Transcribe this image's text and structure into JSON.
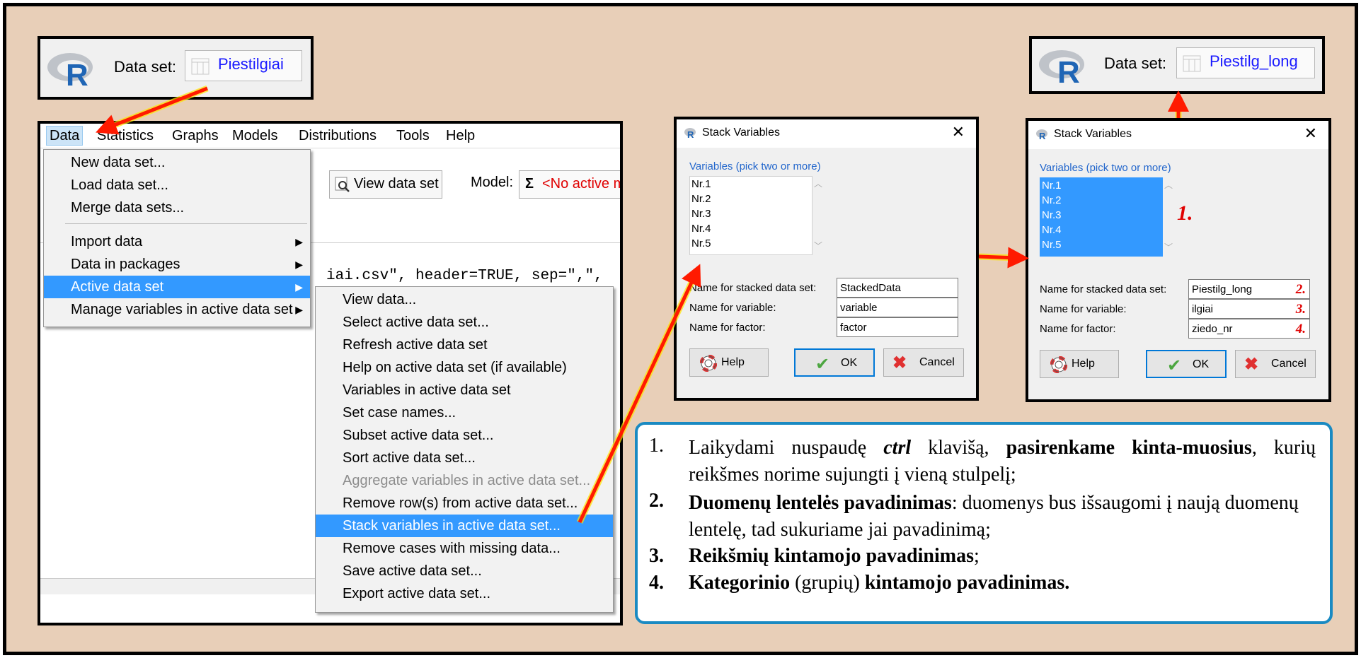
{
  "header_left": {
    "dataset_label": "Data set:",
    "dataset_value": "Piestilgiai"
  },
  "header_right": {
    "dataset_label": "Data set:",
    "dataset_value": "Piestilg_long"
  },
  "menubar": [
    "Data",
    "Statistics",
    "Graphs",
    "Models",
    "Distributions",
    "Tools",
    "Help"
  ],
  "toolbar": {
    "view_data_set": "View data set",
    "model_label": "Model:",
    "model_value": "<No active m"
  },
  "code_line": "iai.csv\", header=TRUE, sep=\",\",",
  "data_menu": {
    "items": [
      "New data set...",
      "Load data set...",
      "Merge data sets...",
      "Import data",
      "Data in packages",
      "Active data set",
      "Manage variables in active data set"
    ]
  },
  "active_menu": {
    "items": [
      "View data...",
      "Select active data set...",
      "Refresh active data set",
      "Help on active data set (if available)",
      "Variables in active data set",
      "Set case names...",
      "Subset active data set...",
      "Sort active data set...",
      "Aggregate variables in active data set...",
      "Remove row(s) from active data set...",
      "Stack variables in active data set...",
      "Remove cases with missing data...",
      "Save active data set...",
      "Export active data set..."
    ]
  },
  "dialog_left": {
    "title": "Stack Variables",
    "close": "✕",
    "list_label": "Variables (pick two or more)",
    "variables": [
      "Nr.1",
      "Nr.2",
      "Nr.3",
      "Nr.4",
      "Nr.5"
    ],
    "fields": [
      {
        "label": "Name for stacked data set:",
        "value": "StackedData"
      },
      {
        "label": "Name for variable:",
        "value": "variable"
      },
      {
        "label": "Name for factor:",
        "value": "factor"
      }
    ],
    "help": "Help",
    "ok": "OK",
    "cancel": "Cancel"
  },
  "dialog_right": {
    "title": "Stack Variables",
    "close": "✕",
    "list_label": "Variables (pick two or more)",
    "variables": [
      "Nr.1",
      "Nr.2",
      "Nr.3",
      "Nr.4",
      "Nr.5"
    ],
    "step1": "1.",
    "fields": [
      {
        "label": "Name for stacked data set:",
        "value": "Piestilg_long",
        "num": "2."
      },
      {
        "label": "Name for variable:",
        "value": "ilgiai",
        "num": "3."
      },
      {
        "label": "Name for factor:",
        "value": "ziedo_nr",
        "num": "4."
      }
    ],
    "help": "Help",
    "ok": "OK",
    "cancel": "Cancel"
  },
  "instructions": [
    {
      "n": "1.",
      "html": "Laikydami nuspaudę <b><i>ctrl</i></b> klavišą, <b>pasirenkame kinta-muosius</b>, kurių reikšmes norime sujungti į vieną stulpelį;"
    },
    {
      "n": "2.",
      "html": "<b>Duomenų lentelės pavadinimas</b>: duomenys bus išsaugomi į naują duomenų lentelę, tad sukuriame jai pavadinimą;"
    },
    {
      "n": "3.",
      "html": "<b>Reikšmių kintamojo pavadinimas</b>;"
    },
    {
      "n": "4.",
      "html": "<b>Kategorinio</b> (grupių) <b>kintamojo pavadinimas.</b>"
    }
  ],
  "colors": {
    "highlight": "#3399ff",
    "arrow": "#ff1a00",
    "info_border": "#1a8ac2",
    "background": "#e8cfb8"
  }
}
